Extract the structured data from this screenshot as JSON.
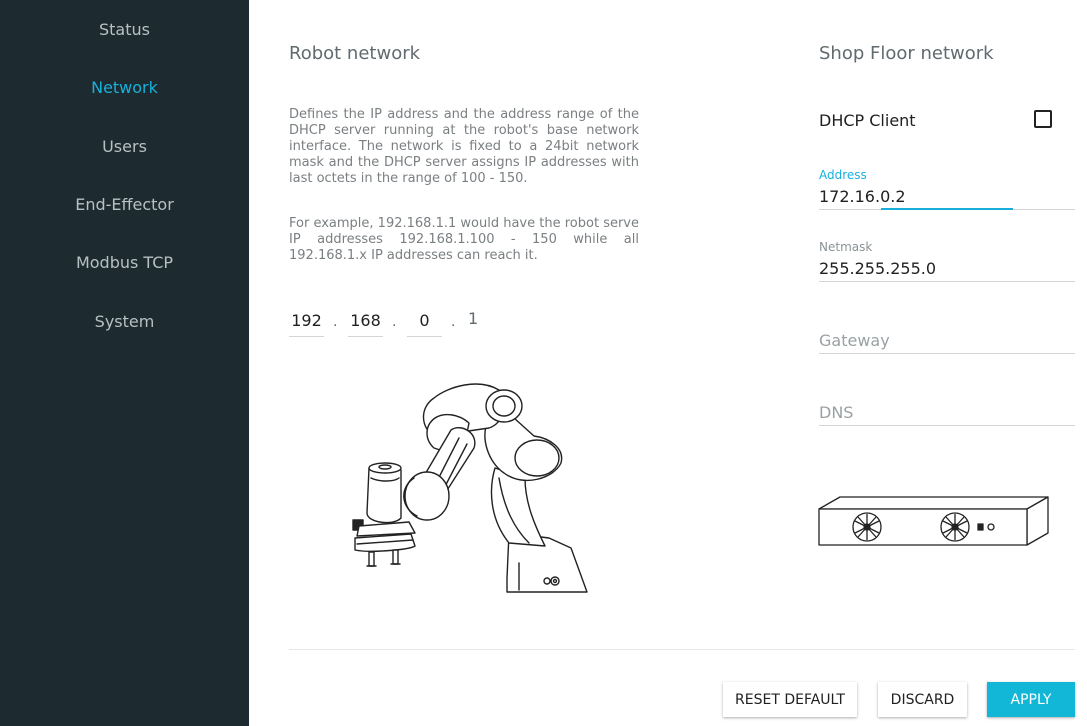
{
  "sidebar": {
    "items": [
      {
        "label": "Status"
      },
      {
        "label": "Network"
      },
      {
        "label": "Users"
      },
      {
        "label": "End-Effector"
      },
      {
        "label": "Modbus TCP"
      },
      {
        "label": "System"
      }
    ],
    "active": "Network"
  },
  "robot_network": {
    "title": "Robot network",
    "description_1": "Defines the IP address and the address range of the DHCP server running at the robot's base network interface. The network is fixed to a 24bit network mask and the DHCP server assigns IP addresses with last octets in the range of 100 - 150.",
    "description_2": "For example, 192.168.1.1 would have the robot serve IP addresses 192.168.1.100 - 150 while all 192.168.1.x IP addresses can reach it.",
    "ip_octets": [
      "192",
      "168",
      "0"
    ],
    "ip_last_octet": "1",
    "separator": "."
  },
  "shop_floor_network": {
    "title": "Shop Floor network",
    "dhcp_label": "DHCP Client",
    "dhcp_checked": false,
    "address": {
      "label": "Address",
      "value": "172.16.0.2"
    },
    "netmask": {
      "label": "Netmask",
      "value": "255.255.255.0"
    },
    "gateway": {
      "placeholder": "Gateway"
    },
    "dns": {
      "placeholder": "DNS"
    }
  },
  "actions": {
    "reset_label": "RESET DEFAULT",
    "discard_label": "DISCARD",
    "apply_label": "APPLY"
  },
  "colors": {
    "sidebar_bg": "#1d2a2f",
    "accent": "#18b0db",
    "apply_bg": "#12b7d8"
  },
  "icons": {
    "robot": "robot-arm-illustration",
    "network_box": "network-switch-illustration"
  }
}
